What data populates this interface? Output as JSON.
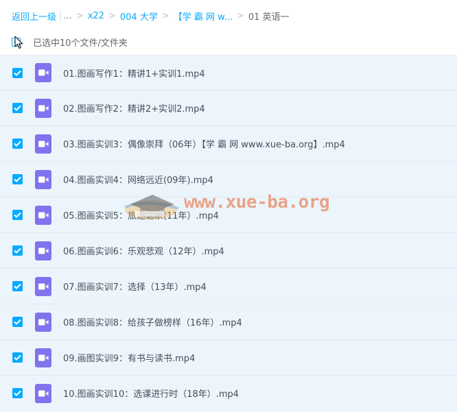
{
  "breadcrumb": {
    "back_label": "返回上一级",
    "ellipsis": "...",
    "items": [
      "x22",
      "004 大学",
      "【学 霸 网 w..."
    ],
    "current": "01 英语一",
    "separator": ">",
    "divider": "|"
  },
  "selection": {
    "summary": "已选中10个文件/文件夹"
  },
  "files": [
    {
      "name": "01.图画写作1：精讲1+实训1.mp4"
    },
    {
      "name": "02.图画写作2：精讲2+实训2.mp4"
    },
    {
      "name": "03.图画实训3：偶像崇拜（06年）【学 霸 网 www.xue-ba.org】.mp4"
    },
    {
      "name": "04.图画实训4：网络远近(09年).mp4"
    },
    {
      "name": "05.图画实训5：旅途之余(11年）.mp4"
    },
    {
      "name": "06.图画实训6：乐观悲观（12年）.mp4"
    },
    {
      "name": "07.图画实训7：选择（13年）.mp4"
    },
    {
      "name": "08.图画实训8：给孩子做榜样（16年）.mp4"
    },
    {
      "name": "09.画图实训9：有书与读书.mp4"
    },
    {
      "name": "10.图画实训10：选课进行时（18年）.mp4"
    }
  ],
  "icons": {
    "file_type": "video-file-icon",
    "checkbox": "checkmark-icon"
  },
  "colors": {
    "accent": "#09aaff",
    "video_icon": "#8173ee",
    "row_selected_bg": "#edf5fc",
    "watermark": "#e46028"
  },
  "watermark": {
    "text": "www.xue-ba.org"
  }
}
